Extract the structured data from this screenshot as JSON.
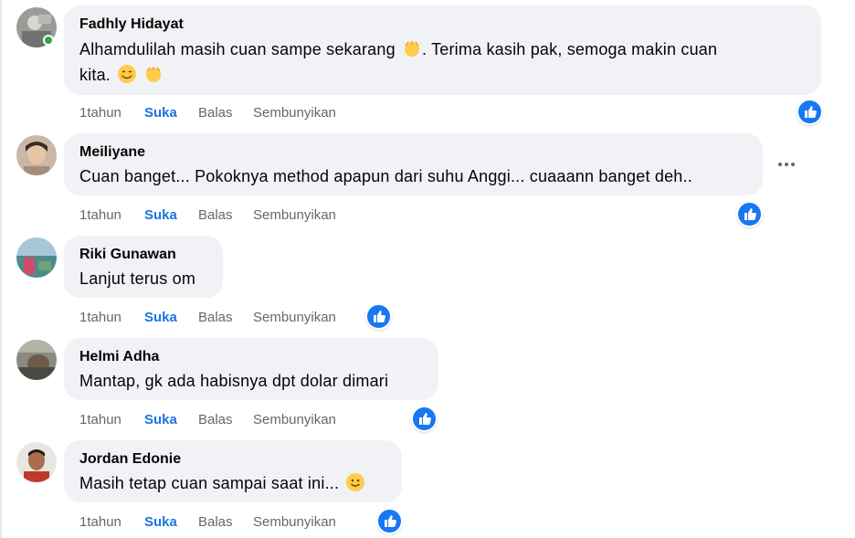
{
  "actions": {
    "time": "1tahun",
    "like": "Suka",
    "reply": "Balas",
    "hide": "Sembunyikan"
  },
  "comments": [
    {
      "author": "Fadhly Hidayat",
      "text_line1": "Alhamdulilah masih cuan sampe sekarang",
      "text_line1b": ". Terima kasih pak, semoga makin cuan",
      "text_line2": "kita.",
      "online": true
    },
    {
      "author": "Meiliyane",
      "text": "Cuan banget... Pokoknya method apapun dari suhu Anggi... cuaaann banget deh.."
    },
    {
      "author": "Riki Gunawan",
      "text": "Lanjut terus om"
    },
    {
      "author": "Helmi Adha",
      "text": "Mantap, gk ada habisnya dpt dolar dimari"
    },
    {
      "author": "Jordan Edonie",
      "text": "Masih tetap cuan sampai saat ini..."
    }
  ],
  "icons": {
    "reaction": "like-reaction-icon",
    "more": "more-options-icon",
    "emoji_hands": "raising-hands-emoji",
    "emoji_smile": "smiling-face-emoji"
  },
  "colors": {
    "bubble": "#f0f2f5",
    "like_blue": "#1877f2",
    "like_text": "#1b74e4",
    "meta_gray": "#65676b",
    "online_green": "#31a24c"
  }
}
